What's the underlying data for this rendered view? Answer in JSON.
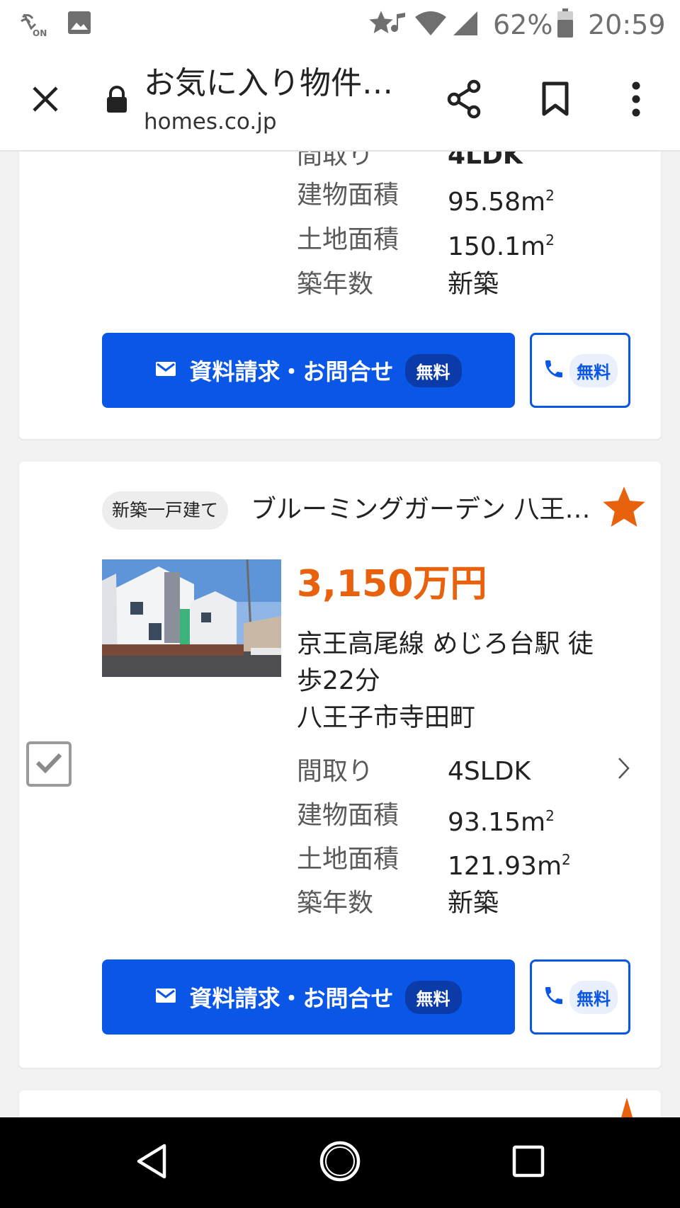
{
  "status_bar": {
    "battery_percent": "62%",
    "time": "20:59",
    "icons": [
      "nfc-on-icon",
      "image-icon",
      "star-icon",
      "music-note-icon",
      "wifi-icon",
      "signal-icon",
      "battery-icon"
    ],
    "nfc_label": "ON"
  },
  "browser": {
    "page_title": "お気に入り物件一覧",
    "domain": "homes.co.jp",
    "icons": [
      "close-icon",
      "lock-icon",
      "share-icon",
      "bookmark-icon",
      "more-vert-icon"
    ]
  },
  "listings": [
    {
      "specs": [
        {
          "label": "間取り",
          "value": "4LDK"
        },
        {
          "label": "建物面積",
          "value": "95.58m",
          "unit_sup": "2"
        },
        {
          "label": "土地面積",
          "value": "150.1m",
          "unit_sup": "2"
        },
        {
          "label": "築年数",
          "value": "新築"
        }
      ],
      "inquiry_button": {
        "label": "資料請求・お問合せ",
        "badge": "無料"
      },
      "phone_button": {
        "badge": "無料"
      }
    },
    {
      "type_tag": "新築一戸建て",
      "name": "ブルーミングガーデン 八王子市寺田町",
      "favorited": true,
      "price": "3,150万円",
      "access": "京王高尾線 めじろ台駅 徒歩22分",
      "address": "八王子市寺田町",
      "checked": true,
      "specs": [
        {
          "label": "間取り",
          "value": "4SLDK"
        },
        {
          "label": "建物面積",
          "value": "93.15m",
          "unit_sup": "2"
        },
        {
          "label": "土地面積",
          "value": "121.93m",
          "unit_sup": "2"
        },
        {
          "label": "築年数",
          "value": "新築"
        }
      ],
      "inquiry_button": {
        "label": "資料請求・お問合せ",
        "badge": "無料"
      },
      "phone_button": {
        "badge": "無料"
      }
    }
  ],
  "colors": {
    "primary": "#0a56e6",
    "price": "#e8610d",
    "favorite_star": "#e8610d"
  },
  "nav_bar": {
    "icons": [
      "back-icon",
      "home-icon",
      "recents-icon"
    ]
  }
}
